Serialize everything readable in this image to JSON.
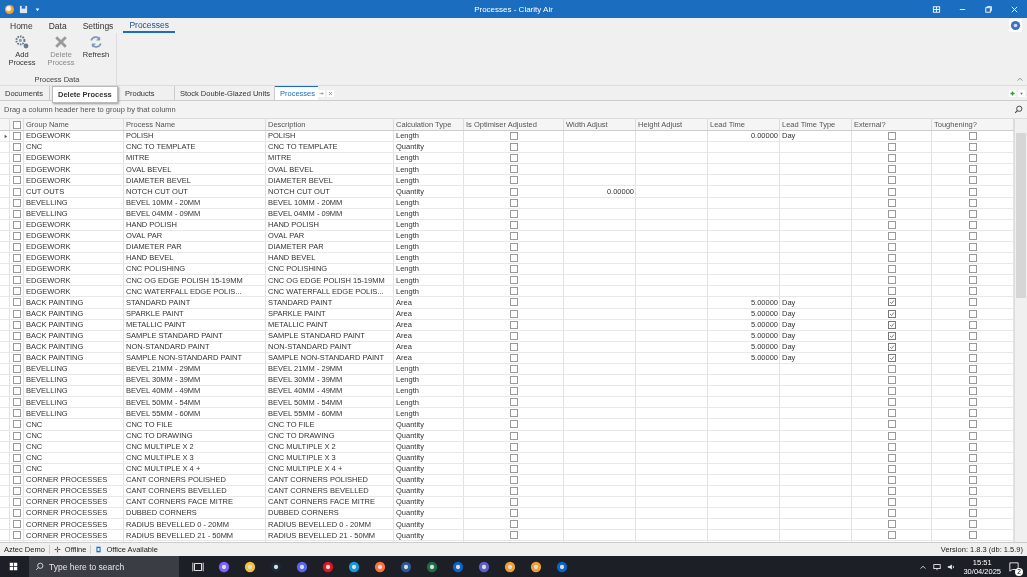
{
  "window": {
    "title": "Processes - Clarity Air"
  },
  "ribbon_tabs": [
    {
      "label": "Home",
      "selected": false
    },
    {
      "label": "Data",
      "selected": false
    },
    {
      "label": "Settings",
      "selected": false
    },
    {
      "label": "Processes",
      "selected": true
    }
  ],
  "ribbon": {
    "buttons": [
      {
        "label": "Add Process",
        "kind": "gears",
        "disabled": false
      },
      {
        "label": "Delete Process",
        "kind": "delete",
        "disabled": true
      },
      {
        "label": "Refresh",
        "kind": "refresh",
        "disabled": false
      }
    ],
    "group_label": "Process Data"
  },
  "tooltip": "Delete Process",
  "doc_tabs": [
    {
      "label": "Documents",
      "selected": false
    },
    {
      "label": "Products",
      "selected": false
    },
    {
      "label": "Stock Double-Glazed Units",
      "selected": false
    },
    {
      "label": "Processes",
      "selected": true
    }
  ],
  "group_panel_hint": "Drag a column header here to group by that column",
  "table": {
    "select_all_checked": false,
    "columns": [
      "Group Name",
      "Process Name",
      "Description",
      "Calculation Type",
      "Is Optimiser Adjusted",
      "Width Adjust",
      "Height Adjust",
      "Lead Time",
      "Lead Time Type",
      "External?",
      "Toughening?"
    ],
    "rows": [
      {
        "current": true,
        "checked": false,
        "group": "EDGEWORK",
        "process": "POLISH",
        "description": "POLISH",
        "calc": "Length",
        "optimiser": false,
        "lead_time": "0.00000",
        "lead_time_type": "Day",
        "external": false,
        "toughening": false
      },
      {
        "current": false,
        "checked": false,
        "group": "CNC",
        "process": "CNC TO TEMPLATE",
        "description": "CNC TO TEMPLATE",
        "calc": "Quantity",
        "optimiser": false,
        "external": false,
        "toughening": false
      },
      {
        "current": false,
        "checked": false,
        "group": "EDGEWORK",
        "process": "MITRE",
        "description": "MITRE",
        "calc": "Length",
        "optimiser": false,
        "external": false,
        "toughening": false
      },
      {
        "current": false,
        "checked": false,
        "group": "EDGEWORK",
        "process": "OVAL BEVEL",
        "description": "OVAL BEVEL",
        "calc": "Length",
        "optimiser": false,
        "external": false,
        "toughening": false
      },
      {
        "current": false,
        "checked": false,
        "group": "EDGEWORK",
        "process": "DIAMETER BEVEL",
        "description": "DIAMETER BEVEL",
        "calc": "Length",
        "optimiser": false,
        "external": false,
        "toughening": false
      },
      {
        "current": false,
        "checked": false,
        "group": "CUT OUTS",
        "process": "NOTCH CUT OUT",
        "description": "NOTCH CUT OUT",
        "calc": "Quantity",
        "optimiser": false,
        "width_adjust": "0.00000",
        "external": false,
        "toughening": false
      },
      {
        "current": false,
        "checked": false,
        "group": "BEVELLING",
        "process": "BEVEL 10MM - 20MM",
        "description": "BEVEL 10MM - 20MM",
        "calc": "Length",
        "optimiser": false,
        "external": false,
        "toughening": false
      },
      {
        "current": false,
        "checked": false,
        "group": "BEVELLING",
        "process": "BEVEL 04MM - 09MM",
        "description": "BEVEL 04MM - 09MM",
        "calc": "Length",
        "optimiser": false,
        "external": false,
        "toughening": false
      },
      {
        "current": false,
        "checked": false,
        "group": "EDGEWORK",
        "process": "HAND POLISH",
        "description": "HAND POLISH",
        "calc": "Length",
        "optimiser": false,
        "external": false,
        "toughening": false
      },
      {
        "current": false,
        "checked": false,
        "group": "EDGEWORK",
        "process": "OVAL PAR",
        "description": "OVAL PAR",
        "calc": "Length",
        "optimiser": false,
        "external": false,
        "toughening": false
      },
      {
        "current": false,
        "checked": false,
        "group": "EDGEWORK",
        "process": "DIAMETER PAR",
        "description": "DIAMETER PAR",
        "calc": "Length",
        "optimiser": false,
        "external": false,
        "toughening": false
      },
      {
        "current": false,
        "checked": false,
        "group": "EDGEWORK",
        "process": "HAND BEVEL",
        "description": "HAND BEVEL",
        "calc": "Length",
        "optimiser": false,
        "external": false,
        "toughening": false
      },
      {
        "current": false,
        "checked": false,
        "group": "EDGEWORK",
        "process": "CNC POLISHING",
        "description": "CNC POLISHING",
        "calc": "Length",
        "optimiser": false,
        "external": false,
        "toughening": false
      },
      {
        "current": false,
        "checked": false,
        "group": "EDGEWORK",
        "process": "CNC OG EDGE POLISH 15-19MM",
        "description": "CNC OG EDGE POLISH 15-19MM",
        "calc": "Length",
        "optimiser": false,
        "external": false,
        "toughening": false
      },
      {
        "current": false,
        "checked": false,
        "group": "EDGEWORK",
        "process": "CNC WATERFALL EDGE POLIS...",
        "description": "CNC WATERFALL EDGE POLIS...",
        "calc": "Length",
        "optimiser": false,
        "external": false,
        "toughening": false
      },
      {
        "current": false,
        "checked": false,
        "group": "BACK PAINTING",
        "process": "STANDARD PAINT",
        "description": "STANDARD PAINT",
        "calc": "Area",
        "optimiser": false,
        "lead_time": "5.00000",
        "lead_time_type": "Day",
        "external": true,
        "toughening": false
      },
      {
        "current": false,
        "checked": false,
        "group": "BACK PAINTING",
        "process": "SPARKLE PAINT",
        "description": "SPARKLE PAINT",
        "calc": "Area",
        "optimiser": false,
        "lead_time": "5.00000",
        "lead_time_type": "Day",
        "external": true,
        "toughening": false
      },
      {
        "current": false,
        "checked": false,
        "group": "BACK PAINTING",
        "process": "METALLIC PAINT",
        "description": "METALLIC PAINT",
        "calc": "Area",
        "optimiser": false,
        "lead_time": "5.00000",
        "lead_time_type": "Day",
        "external": true,
        "toughening": false
      },
      {
        "current": false,
        "checked": false,
        "group": "BACK PAINTING",
        "process": "SAMPLE STANDARD PAINT",
        "description": "SAMPLE STANDARD PAINT",
        "calc": "Area",
        "optimiser": false,
        "lead_time": "5.00000",
        "lead_time_type": "Day",
        "external": true,
        "toughening": false
      },
      {
        "current": false,
        "checked": false,
        "group": "BACK PAINTING",
        "process": "NON-STANDARD PAINT",
        "description": "NON-STANDARD PAINT",
        "calc": "Area",
        "optimiser": false,
        "lead_time": "5.00000",
        "lead_time_type": "Day",
        "external": true,
        "toughening": false
      },
      {
        "current": false,
        "checked": false,
        "group": "BACK PAINTING",
        "process": "SAMPLE NON-STANDARD PAINT",
        "description": "SAMPLE NON-STANDARD PAINT",
        "calc": "Area",
        "optimiser": false,
        "lead_time": "5.00000",
        "lead_time_type": "Day",
        "external": true,
        "toughening": false
      },
      {
        "current": false,
        "checked": false,
        "group": "BEVELLING",
        "process": "BEVEL 21MM - 29MM",
        "description": "BEVEL 21MM - 29MM",
        "calc": "Length",
        "optimiser": false,
        "external": false,
        "toughening": false
      },
      {
        "current": false,
        "checked": false,
        "group": "BEVELLING",
        "process": "BEVEL 30MM - 39MM",
        "description": "BEVEL 30MM - 39MM",
        "calc": "Length",
        "optimiser": false,
        "external": false,
        "toughening": false
      },
      {
        "current": false,
        "checked": false,
        "group": "BEVELLING",
        "process": "BEVEL 40MM - 49MM",
        "description": "BEVEL 40MM - 49MM",
        "calc": "Length",
        "optimiser": false,
        "external": false,
        "toughening": false
      },
      {
        "current": false,
        "checked": false,
        "group": "BEVELLING",
        "process": "BEVEL 50MM - 54MM",
        "description": "BEVEL 50MM - 54MM",
        "calc": "Length",
        "optimiser": false,
        "external": false,
        "toughening": false
      },
      {
        "current": false,
        "checked": false,
        "group": "BEVELLING",
        "process": "BEVEL 55MM - 60MM",
        "description": "BEVEL 55MM - 60MM",
        "calc": "Length",
        "optimiser": false,
        "external": false,
        "toughening": false
      },
      {
        "current": false,
        "checked": false,
        "group": "CNC",
        "process": "CNC TO FILE",
        "description": "CNC TO FILE",
        "calc": "Quantity",
        "optimiser": false,
        "external": false,
        "toughening": false
      },
      {
        "current": false,
        "checked": false,
        "group": "CNC",
        "process": "CNC TO DRAWING",
        "description": "CNC TO DRAWING",
        "calc": "Quantity",
        "optimiser": false,
        "external": false,
        "toughening": false
      },
      {
        "current": false,
        "checked": false,
        "group": "CNC",
        "process": "CNC MULTIPLE X 2",
        "description": "CNC MULTIPLE X 2",
        "calc": "Quantity",
        "optimiser": false,
        "external": false,
        "toughening": false
      },
      {
        "current": false,
        "checked": false,
        "group": "CNC",
        "process": "CNC MULTIPLE X 3",
        "description": "CNC MULTIPLE X 3",
        "calc": "Quantity",
        "optimiser": false,
        "external": false,
        "toughening": false
      },
      {
        "current": false,
        "checked": false,
        "group": "CNC",
        "process": "CNC MULTIPLE X 4 +",
        "description": "CNC MULTIPLE X 4 +",
        "calc": "Quantity",
        "optimiser": false,
        "external": false,
        "toughening": false
      },
      {
        "current": false,
        "checked": false,
        "group": "CORNER PROCESSES",
        "process": "CANT CORNERS POLISHED",
        "description": "CANT CORNERS POLISHED",
        "calc": "Quantity",
        "optimiser": false,
        "external": false,
        "toughening": false
      },
      {
        "current": false,
        "checked": false,
        "group": "CORNER PROCESSES",
        "process": "CANT CORNERS BEVELLED",
        "description": "CANT CORNERS BEVELLED",
        "calc": "Quantity",
        "optimiser": false,
        "external": false,
        "toughening": false
      },
      {
        "current": false,
        "checked": false,
        "group": "CORNER PROCESSES",
        "process": "CANT CORNERS FACE MITRE",
        "description": "CANT CORNERS FACE MITRE",
        "calc": "Quantity",
        "optimiser": false,
        "external": false,
        "toughening": false
      },
      {
        "current": false,
        "checked": false,
        "group": "CORNER PROCESSES",
        "process": "DUBBED CORNERS",
        "description": "DUBBED CORNERS",
        "calc": "Quantity",
        "optimiser": false,
        "external": false,
        "toughening": false
      },
      {
        "current": false,
        "checked": false,
        "group": "CORNER PROCESSES",
        "process": "RADIUS BEVELLED 0 - 20MM",
        "description": "RADIUS BEVELLED 0 - 20MM",
        "calc": "Quantity",
        "optimiser": false,
        "external": false,
        "toughening": false
      },
      {
        "current": false,
        "checked": false,
        "group": "CORNER PROCESSES",
        "process": "RADIUS BEVELLED 21 - 50MM",
        "description": "RADIUS BEVELLED 21 - 50MM",
        "calc": "Quantity",
        "optimiser": false,
        "external": false,
        "toughening": false
      }
    ]
  },
  "status_bar": {
    "company": "Aztec Demo",
    "connection": "Offline",
    "office": "Office Available",
    "version": "Version: 1.8.3 (db: 1.5.9)"
  },
  "taskbar": {
    "search_placeholder": "Type here to search",
    "time": "15:51",
    "date": "30/04/2025",
    "notifications": "2"
  }
}
